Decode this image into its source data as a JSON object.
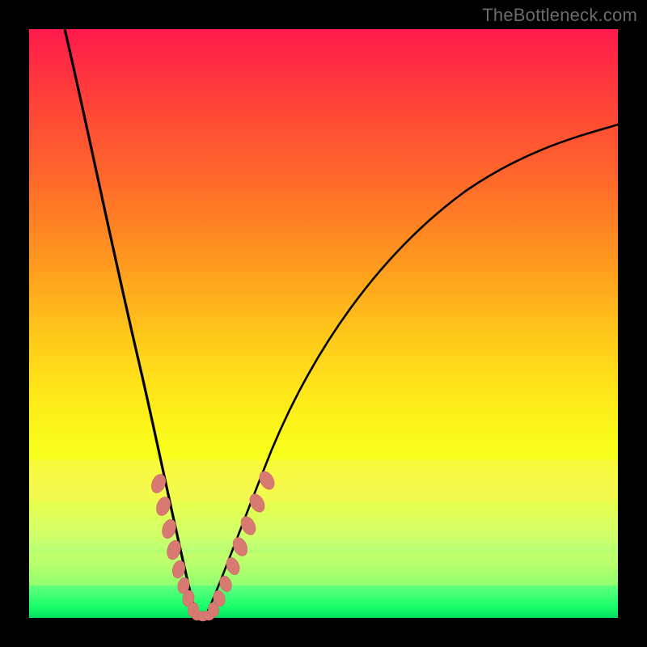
{
  "watermark": "TheBottleneck.com",
  "chart_data": {
    "type": "line",
    "title": "",
    "xlabel": "",
    "ylabel": "",
    "xlim": [
      0,
      100
    ],
    "ylim": [
      0,
      100
    ],
    "grid": false,
    "legend": false,
    "series": [
      {
        "name": "left-branch",
        "x": [
          6,
          8,
          10,
          12,
          14,
          16,
          18,
          20,
          22,
          23.5,
          25,
          26.5,
          28
        ],
        "y": [
          100,
          90,
          80,
          69,
          58,
          47,
          37,
          27,
          18,
          12,
          7,
          3,
          0
        ]
      },
      {
        "name": "right-branch",
        "x": [
          30,
          31.5,
          33,
          35,
          38,
          42,
          47,
          53,
          60,
          68,
          77,
          86,
          95,
          100
        ],
        "y": [
          0,
          3,
          7,
          13,
          22,
          32,
          42,
          52,
          60,
          68,
          74,
          79,
          82,
          84
        ]
      }
    ],
    "markers": {
      "left": [
        {
          "x": 21.0,
          "y": 22.5
        },
        {
          "x": 22.0,
          "y": 18.0
        },
        {
          "x": 23.0,
          "y": 14.0
        },
        {
          "x": 23.8,
          "y": 10.5
        },
        {
          "x": 24.8,
          "y": 7.5
        },
        {
          "x": 25.5,
          "y": 5.0
        },
        {
          "x": 26.3,
          "y": 2.8
        },
        {
          "x": 27.4,
          "y": 1.0
        }
      ],
      "bottom": [
        {
          "x": 28.0,
          "y": 0.0
        },
        {
          "x": 28.8,
          "y": 0.0
        },
        {
          "x": 29.6,
          "y": 0.0
        }
      ],
      "right": [
        {
          "x": 30.5,
          "y": 1.0
        },
        {
          "x": 31.3,
          "y": 2.8
        },
        {
          "x": 32.2,
          "y": 5.5
        },
        {
          "x": 33.2,
          "y": 8.5
        },
        {
          "x": 34.3,
          "y": 12.0
        },
        {
          "x": 35.5,
          "y": 15.5
        },
        {
          "x": 37.0,
          "y": 19.5
        },
        {
          "x": 38.5,
          "y": 23.5
        }
      ]
    },
    "gradient_bands": [
      {
        "color": "#ff1a4d",
        "from": 100,
        "to": 90
      },
      {
        "color": "#ff6a2a",
        "from": 74,
        "to": 60
      },
      {
        "color": "#ffe81a",
        "from": 38,
        "to": 28
      },
      {
        "color": "#1aff6a",
        "from": 2,
        "to": 0
      }
    ]
  }
}
